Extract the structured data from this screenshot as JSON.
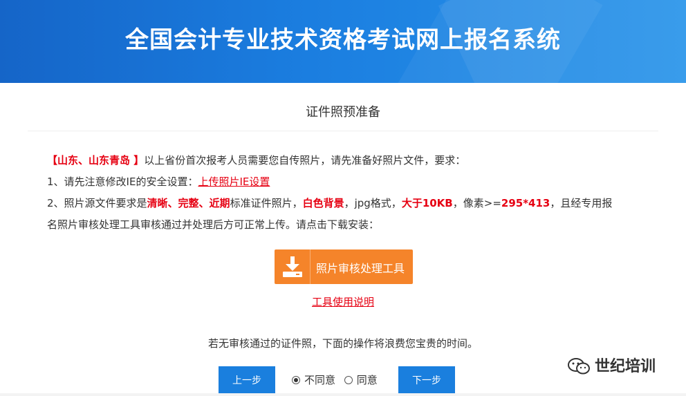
{
  "header": {
    "title": "全国会计专业技术资格考试网上报名系统"
  },
  "section": {
    "title": "证件照预准备"
  },
  "notice": {
    "region": "【山东、山东青岛 】",
    "intro": "以上省份首次报考人员需要您自传照片，请先准备好照片文件，要求：",
    "item1_prefix": "1、请先注意修改IE的安全设置：",
    "item1_link": "上传照片IE设置",
    "item2_a": "2、照片源文件要求是",
    "item2_b": "清晰、完整、近期",
    "item2_c": "标准证件照片，",
    "item2_d": "白色背景",
    "item2_e": "，jpg格式，",
    "item2_f": "大于10KB",
    "item2_g": "，像素>=",
    "item2_h": "295*413",
    "item2_i": "，且经专用报",
    "item2_line2": "名照片审核处理工具审核通过并处理后方可正常上传。请点击下载安装："
  },
  "download": {
    "label": "照片审核处理工具",
    "icon": "download-icon",
    "color": "#f5842a"
  },
  "help_link": "工具使用说明",
  "warning": "若无审核通过的证件照，下面的操作将浪费您宝贵的时间。",
  "agreement": {
    "options": [
      "不同意",
      "同意"
    ],
    "selected": "不同意"
  },
  "buttons": {
    "prev": "上一步",
    "next": "下一步"
  },
  "watermark": {
    "text": "世纪培训",
    "icon": "wechat-icon"
  },
  "colors": {
    "accent": "#1a7fde",
    "highlight": "#e60012"
  }
}
